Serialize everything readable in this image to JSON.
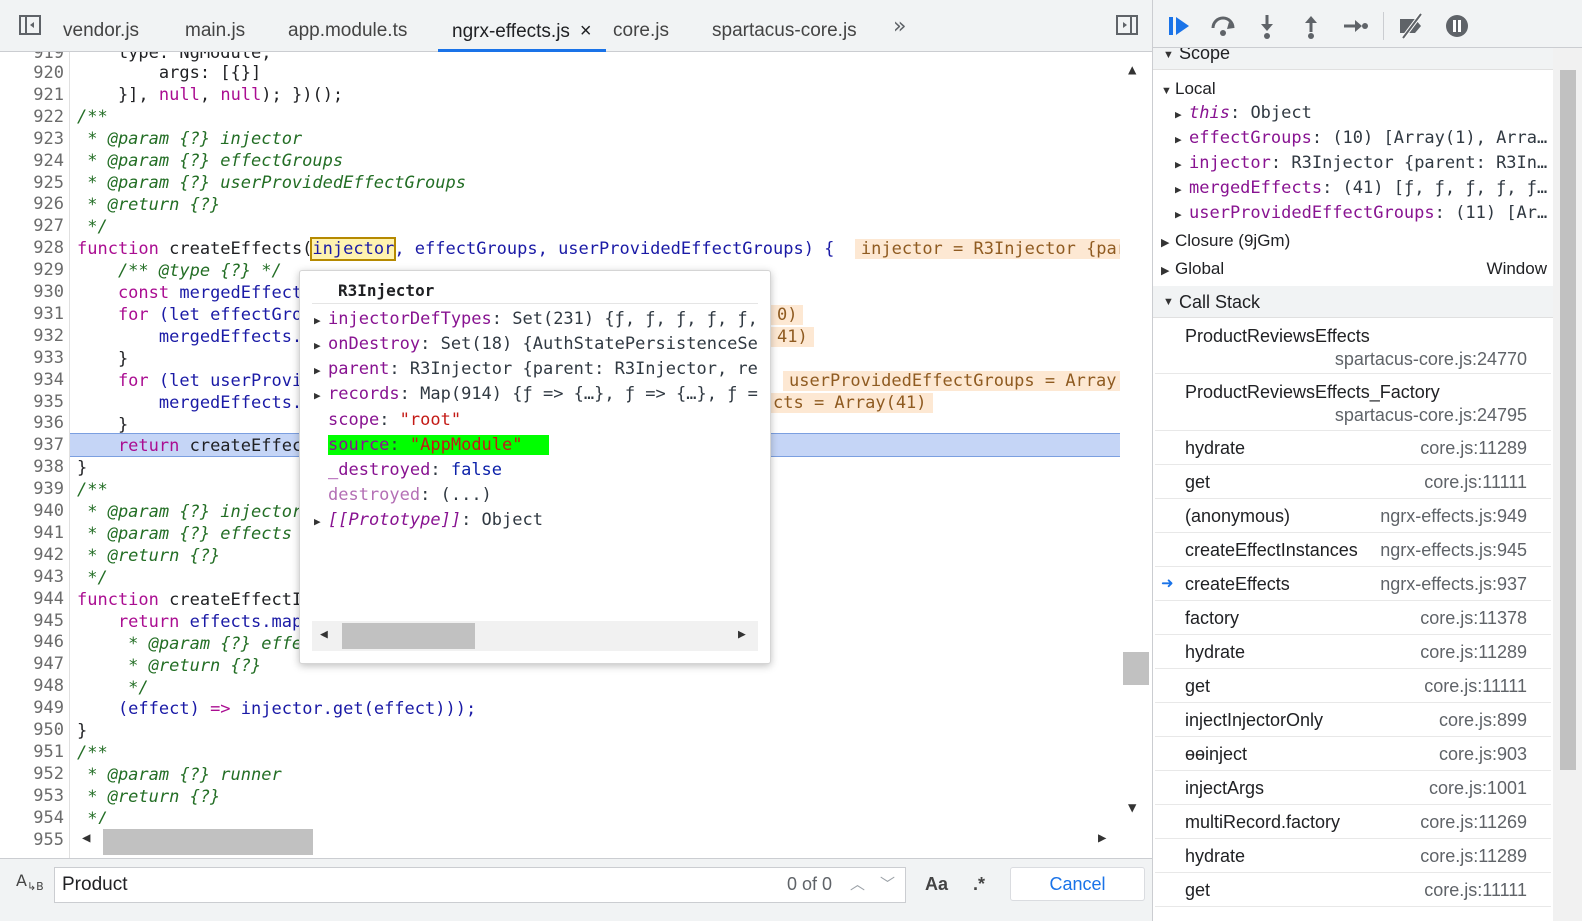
{
  "tabs": [
    {
      "label": "vendor.js"
    },
    {
      "label": "main.js"
    },
    {
      "label": "app.module.ts"
    },
    {
      "label": "ngrx-effects.js",
      "active": true
    },
    {
      "label": "core.js"
    },
    {
      "label": "spartacus-core.js"
    }
  ],
  "tab_close_glyph": "×",
  "tab_more_glyph": "»",
  "editor": {
    "partial_top_line": "    type: NgModule,",
    "line_numbers": [
      "920",
      "921",
      "922",
      "923",
      "924",
      "925",
      "926",
      "927",
      "928",
      "929",
      "930",
      "931",
      "932",
      "933",
      "934",
      "935",
      "936",
      "937",
      "938",
      "939",
      "940",
      "941",
      "942",
      "943",
      "944",
      "945",
      "946",
      "947",
      "948",
      "949",
      "950",
      "951",
      "952",
      "953",
      "954",
      "955"
    ],
    "partial_top_number": "919",
    "lines": {
      "l920": "        args: [{}]",
      "l921a": "    }], ",
      "l921b": "null",
      "l921c": ", ",
      "l921d": "null",
      "l921e": "); })();",
      "l922": "/**",
      "l923": " * @param {?} injector",
      "l924": " * @param {?} effectGroups",
      "l925": " * @param {?} userProvidedEffectGroups",
      "l926": " * @return {?}",
      "l927": " */",
      "l928_kw": "function",
      "l928_fn": " createEffects(",
      "l928_hl": "injector",
      "l928_rest": ", effectGroups, userProvidedEffectGroups) {",
      "l928_inline": "injector = R3Injector {parent",
      "l929": "    /** @type {?} */",
      "l930_kw": "    const",
      "l930_rest": " mergedEffect",
      "l931_kw": "    for",
      "l931_rest": " (let effectGro",
      "l931_inline": "0)",
      "l932": "        mergedEffects.",
      "l932_inline": "41)",
      "l933": "    }",
      "l934_kw": "    for",
      "l934_rest": " (let userProvi",
      "l934_inline": "userProvidedEffectGroups = Array",
      "l935": "        mergedEffects.",
      "l935_inline": "cts = Array(41)",
      "l936": "    }",
      "l937_kw": "    return",
      "l937_rest": " createEffec",
      "l938": "}",
      "l939": "/**",
      "l940": " * @param {?} injector",
      "l941": " * @param {?} effects",
      "l942": " * @return {?}",
      "l943": " */",
      "l944_kw": "function",
      "l944_rest": " createEffectI",
      "l945_kw": "    return",
      "l945_rest": " effects.map",
      "l946": "     * @param {?} effe",
      "l947": "     * @return {?}",
      "l948": "     */",
      "l949a": "    (effect) ",
      "l949b": "=>",
      "l949c": " injector.get(effect)));",
      "l950": "}",
      "l951": "/**",
      "l952": " * @param {?} runner",
      "l953": " * @return {?}",
      "l954": " */"
    }
  },
  "popover": {
    "title": "R3Injector",
    "rows": [
      {
        "key": "injectorDefTypes",
        "value": "Set(231) {ƒ, ƒ, ƒ, ƒ, ƒ, ƒ",
        "expandable": true
      },
      {
        "key": "onDestroy",
        "value": "Set(18) {AuthStatePersistenceSe",
        "expandable": true
      },
      {
        "key": "parent",
        "value": "R3Injector {parent: R3Injector, re",
        "expandable": true
      },
      {
        "key": "records",
        "value": "Map(914) {ƒ => {…}, ƒ => {…}, ƒ =",
        "expandable": true
      },
      {
        "key": "scope",
        "value": "\"root\"",
        "expandable": false
      },
      {
        "key": "source",
        "value": "\"AppModule\"",
        "expandable": false,
        "highlighted": true
      },
      {
        "key": "_destroyed",
        "value": "false",
        "expandable": false
      },
      {
        "key": "destroyed",
        "value": "(...)",
        "expandable": false,
        "dim": true
      },
      {
        "key": "[[Prototype]]",
        "value": "Object",
        "expandable": true
      }
    ]
  },
  "search": {
    "value": "Product",
    "count": "0 of 0",
    "case_label": "Aa",
    "regex_label": ".*",
    "cancel_label": "Cancel",
    "ab_icon_label": "Aᴬ B"
  },
  "scope": {
    "header": "Scope",
    "local_header": "Local",
    "local_rows": [
      {
        "key": "this",
        "value": "Object",
        "italic": true
      },
      {
        "key": "effectGroups",
        "value": "(10) [Array(1), Arra…"
      },
      {
        "key": "injector",
        "value": "R3Injector {parent: R3In…"
      },
      {
        "key": "mergedEffects",
        "value": "(41) [ƒ, ƒ, ƒ, ƒ, ƒ…"
      },
      {
        "key": "userProvidedEffectGroups",
        "value": "(11) [Ar…"
      }
    ],
    "closure_label": "Closure (9jGm)",
    "global_label": "Global",
    "global_value": "Window"
  },
  "call_stack": {
    "header": "Call Stack",
    "frames": [
      {
        "name": "ProductReviewsEffects",
        "location": "spartacus-core.js:24770",
        "two_line": true
      },
      {
        "name": "ProductReviewsEffects_Factory",
        "location": "spartacus-core.js:24795",
        "two_line": true
      },
      {
        "name": "hydrate",
        "location": "core.js:11289"
      },
      {
        "name": "get",
        "location": "core.js:11111"
      },
      {
        "name": "(anonymous)",
        "location": "ngrx-effects.js:949"
      },
      {
        "name": "createEffectInstances",
        "location": "ngrx-effects.js:945"
      },
      {
        "name": "createEffects",
        "location": "ngrx-effects.js:937",
        "current": true
      },
      {
        "name": "factory",
        "location": "core.js:11378"
      },
      {
        "name": "hydrate",
        "location": "core.js:11289"
      },
      {
        "name": "get",
        "location": "core.js:11111"
      },
      {
        "name": "injectInjectorOnly",
        "location": "core.js:899"
      },
      {
        "name": "ɵɵinject",
        "location": "core.js:903"
      },
      {
        "name": "injectArgs",
        "location": "core.js:1001"
      },
      {
        "name": "multiRecord.factory",
        "location": "core.js:11269"
      },
      {
        "name": "hydrate",
        "location": "core.js:11289"
      },
      {
        "name": "get",
        "location": "core.js:11111"
      }
    ]
  },
  "colors": {
    "accent": "#1a73e8",
    "current_line": "#c5d5f6",
    "highlight_green": "#00ff00",
    "inline_value_bg": "#fde8d3"
  }
}
